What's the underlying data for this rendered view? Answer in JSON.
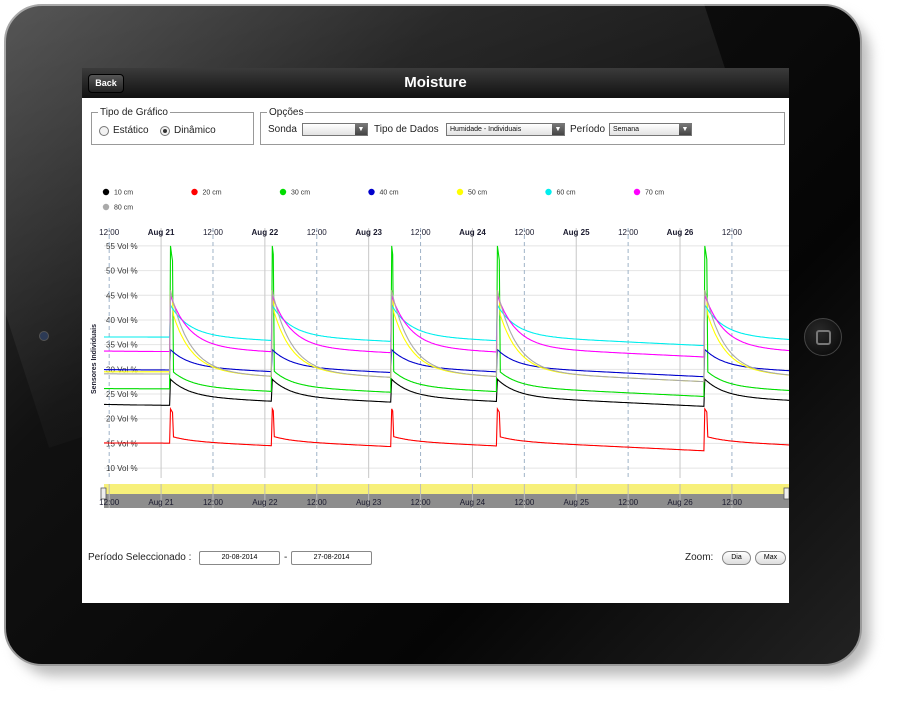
{
  "nav": {
    "back_label": "Back",
    "title": "Moisture"
  },
  "chart_type_box": {
    "legend": "Tipo de Gráfico",
    "options": [
      {
        "label": "Estático",
        "selected": false
      },
      {
        "label": "Dinâmico",
        "selected": true
      }
    ]
  },
  "options_box": {
    "legend": "Opções",
    "sonda_label": "Sonda",
    "sonda_value": "",
    "data_type_label": "Tipo de Dados",
    "data_type_value": "Humidade - Individuais",
    "period_label": "Período",
    "period_value": "Semana"
  },
  "bottom": {
    "period_label": "Período Seleccionado :",
    "start_date": "20-08-2014",
    "separator": "-",
    "end_date": "27-08-2014",
    "zoom_label": "Zoom:",
    "zoom_day": "Dia",
    "zoom_max": "Max"
  },
  "colors": {
    "highlight_band": "#f7f07a",
    "navigator_band": "#8d8d8d"
  },
  "chart_data": {
    "type": "line",
    "ylabel": "Sensores Individuais",
    "yticks": [
      "10 Vol %",
      "15 Vol %",
      "20 Vol %",
      "25 Vol %",
      "30 Vol %",
      "35 Vol %",
      "40 Vol %",
      "45 Vol %",
      "50 Vol %",
      "55 Vol %"
    ],
    "ylim": [
      8,
      57
    ],
    "xlim": [
      20.45,
      27.05
    ],
    "x_ticks": [
      {
        "x": 20.5,
        "label": "12:00",
        "bold": false
      },
      {
        "x": 21.0,
        "label": "Aug 21",
        "bold": true
      },
      {
        "x": 21.5,
        "label": "12:00",
        "bold": false
      },
      {
        "x": 22.0,
        "label": "Aug 22",
        "bold": true
      },
      {
        "x": 22.5,
        "label": "12:00",
        "bold": false
      },
      {
        "x": 23.0,
        "label": "Aug 23",
        "bold": true
      },
      {
        "x": 23.5,
        "label": "12:00",
        "bold": false
      },
      {
        "x": 24.0,
        "label": "Aug 24",
        "bold": true
      },
      {
        "x": 24.5,
        "label": "12:00",
        "bold": false
      },
      {
        "x": 25.0,
        "label": "Aug 25",
        "bold": true
      },
      {
        "x": 25.5,
        "label": "12:00",
        "bold": false
      },
      {
        "x": 26.0,
        "label": "Aug 26",
        "bold": true
      },
      {
        "x": 26.5,
        "label": "12:00",
        "bold": false
      }
    ],
    "navigator_labels": [
      "12:00",
      "Aug 21",
      "12:00",
      "Aug 22",
      "12:00",
      "Aug 23",
      "12:00",
      "Aug 24",
      "12:00",
      "Aug 25",
      "12:00",
      "Aug 26",
      "12:00"
    ],
    "events": [
      21.09,
      22.07,
      23.22,
      24.24,
      26.24
    ],
    "legend_placement": "top",
    "series": [
      {
        "name": "10 cm",
        "color": "#000000",
        "base": 22.5,
        "jump": 28,
        "decay_to": 24.5,
        "spike": 0
      },
      {
        "name": "20 cm",
        "color": "#ff0000",
        "base": 15.0,
        "jump": 16.5,
        "decay_to": 15.5,
        "spike": 22
      },
      {
        "name": "30 cm",
        "color": "#00dd00",
        "base": 26.0,
        "jump": 30,
        "decay_to": 26.5,
        "spike": 55
      },
      {
        "name": "40 cm",
        "color": "#0000cc",
        "base": 29.8,
        "jump": 34,
        "decay_to": 30.5,
        "spike": 0
      },
      {
        "name": "50 cm",
        "color": "#ffff00",
        "base": 29.5,
        "jump": 43,
        "decay_to": 29.5,
        "spike": 46
      },
      {
        "name": "60 cm",
        "color": "#00eeee",
        "base": 36.5,
        "jump": 43,
        "decay_to": 36.8,
        "spike": 0
      },
      {
        "name": "70 cm",
        "color": "#ff00ff",
        "base": 33.5,
        "jump": 45,
        "decay_to": 34.5,
        "spike": 0
      },
      {
        "name": "80 cm",
        "color": "#aaaaaa",
        "base": 29.0,
        "jump": 46,
        "decay_to": 29.5,
        "spike": 0
      }
    ]
  }
}
